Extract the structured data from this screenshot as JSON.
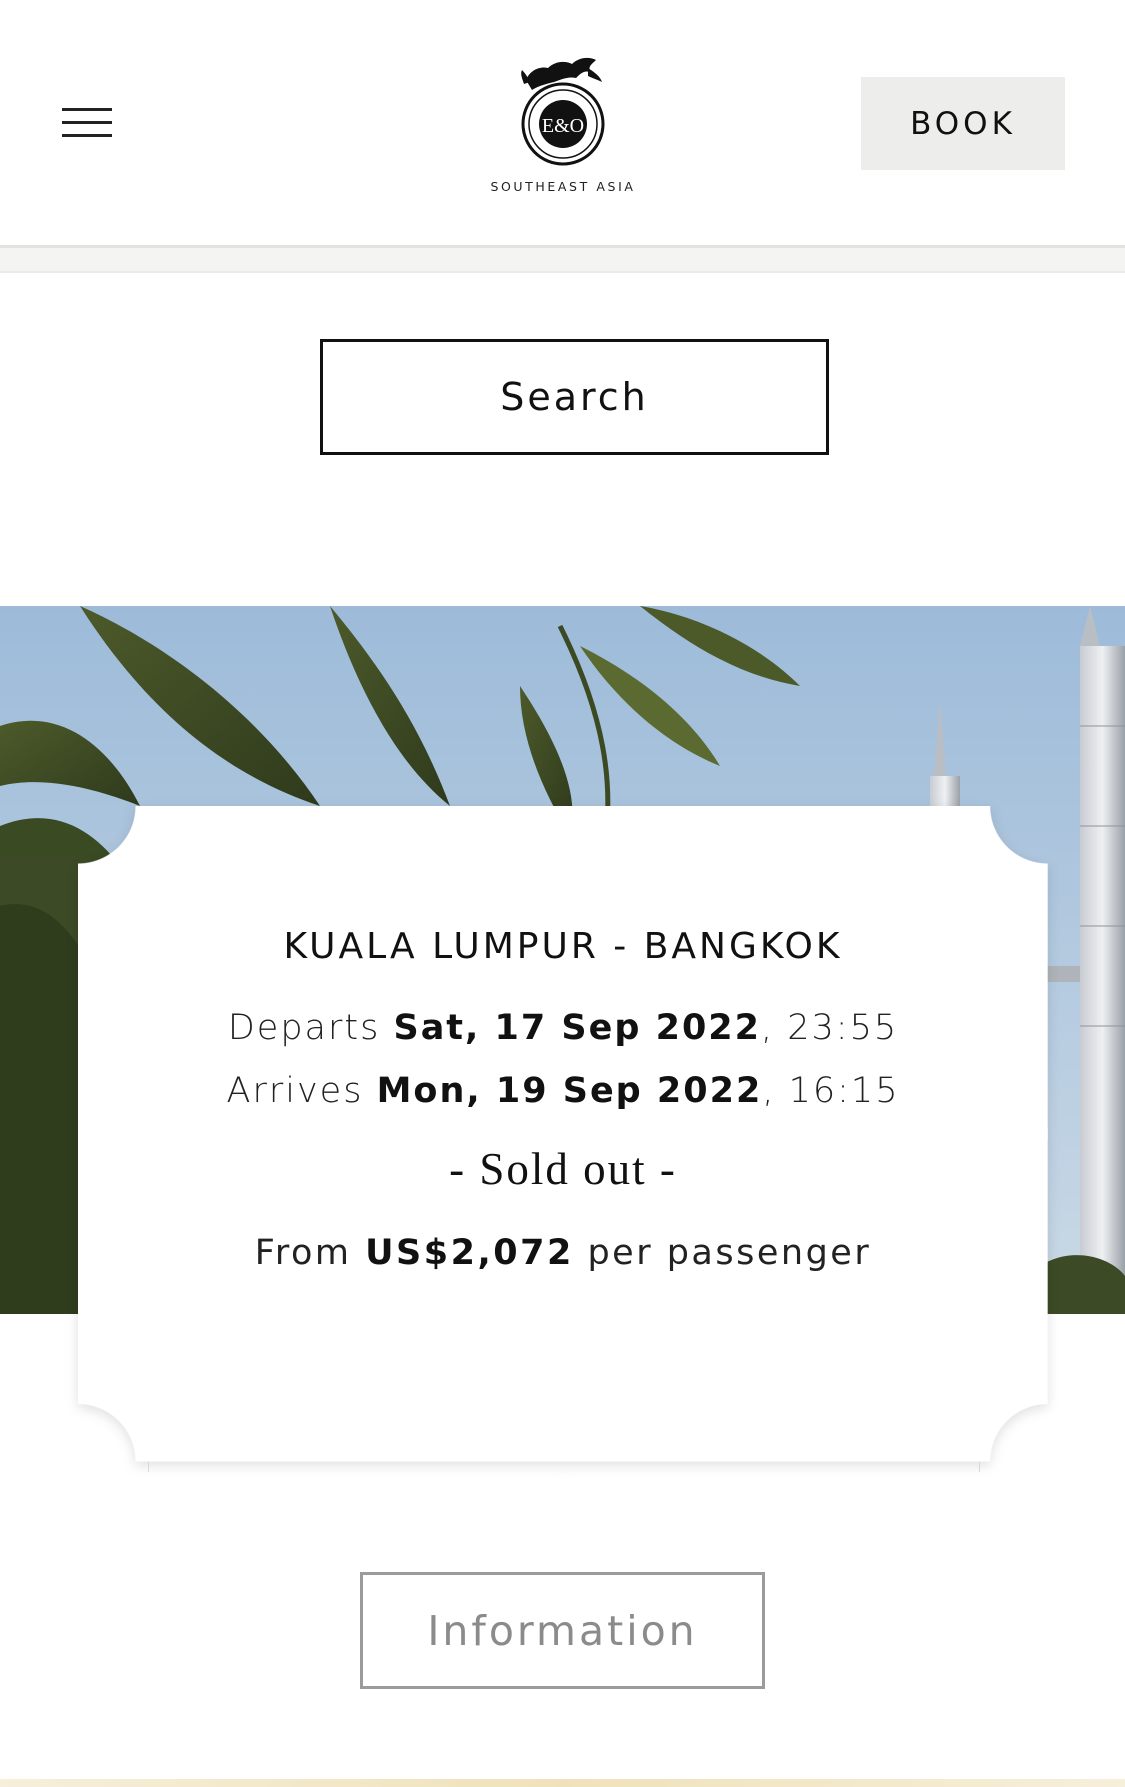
{
  "header": {
    "menu_icon": "hamburger-menu-icon",
    "logo": {
      "emblem_text": "E&O",
      "subtitle": "SOUTHEAST ASIA"
    },
    "book_label": "BOOK"
  },
  "search": {
    "label": "Search"
  },
  "journey": {
    "route": "KUALA LUMPUR - BANGKOK",
    "departs": {
      "prefix": "Departs ",
      "date": "Sat, 17 Sep 2022",
      "time": ", 23:55"
    },
    "arrives": {
      "prefix": "Arrives ",
      "date": "Mon, 19 Sep 2022",
      "time": ", 16:15"
    },
    "status": "- Sold out -",
    "price": {
      "prefix": "From ",
      "amount": "US$2,072",
      "suffix": " per passenger"
    }
  },
  "information": {
    "label": "Information"
  },
  "colors": {
    "book_bg": "#ededec",
    "text": "#111111",
    "info_border": "#9b9b9b",
    "info_text": "#8b8b8b",
    "sky": "#a9c3dd"
  }
}
